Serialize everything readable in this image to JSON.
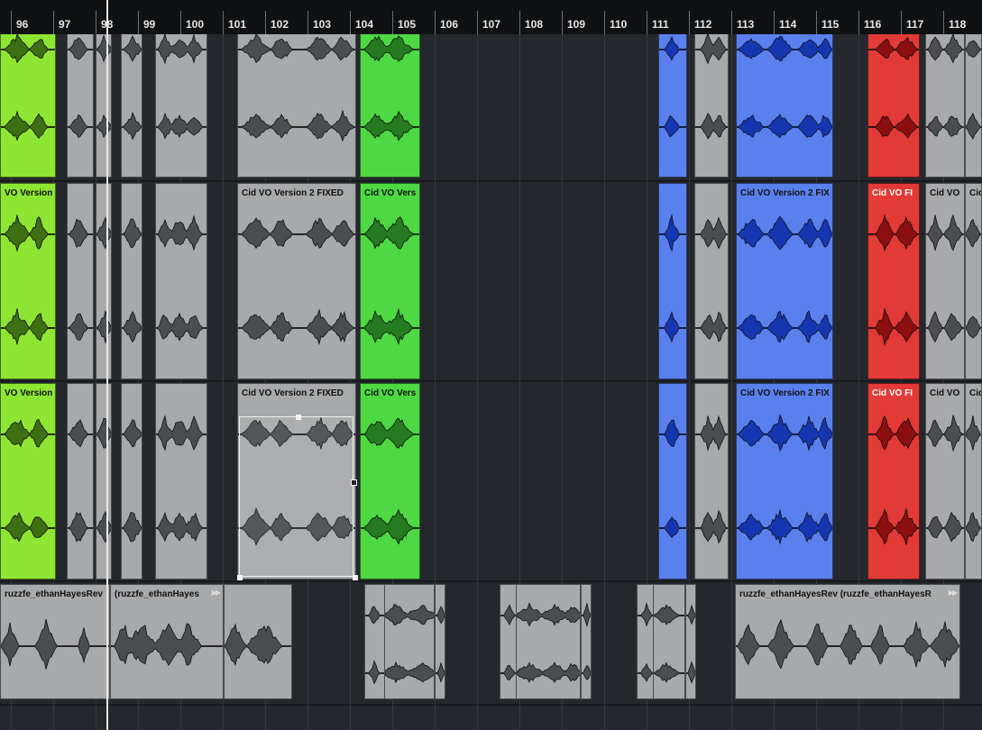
{
  "ruler": {
    "bars": [
      "96",
      "97",
      "98",
      "99",
      "100",
      "101",
      "102",
      "103",
      "104",
      "105",
      "106",
      "107",
      "108",
      "109",
      "110",
      "111",
      "112",
      "113",
      "114",
      "115",
      "116",
      "117",
      "118"
    ]
  },
  "labels": {
    "grey_lane2": "Cid VO Version 2 FIXED",
    "grey_lane3": "Cid VO Version 2 FIXED",
    "lime_lane2": "VO Version",
    "lime_lane3": "VO Version",
    "green_lane2": "Cid VO Vers",
    "green_lane3": "Cid VO Vers",
    "blue_lane2": "Cid VO Version 2 FIX",
    "blue_lane3": "Cid VO Version 2 FIX",
    "red_lane2": "Cid VO FI",
    "red_lane3": "Cid VO FI",
    "right_grey_a_lane2": "Cid VO",
    "right_grey_a_lane3": "Cid VO",
    "right_grey_b_lane2": "Cid",
    "right_grey_b_lane3": "Cid",
    "music_event_1": "ruzzfe_ethanHayesRev",
    "music_event_2": "(ruzzfe_ethanHayes",
    "music_event_3": "ruzzfe_ethanHayesRev (ruzzfe_ethanHayesR"
  },
  "colors": {
    "lime": "#8ee633",
    "green": "#4ed843",
    "blue": "#5a80ee",
    "red": "#e23a36",
    "grey_event": "#a7a9ab",
    "wave_grey": "#4b4e51",
    "wave_lime": "#3e6f12",
    "wave_green": "#267a21",
    "wave_blue": "#1536b0",
    "wave_red": "#8c0f0f",
    "background": "#23272b"
  },
  "icons": {
    "play_icon": "▶▶"
  }
}
